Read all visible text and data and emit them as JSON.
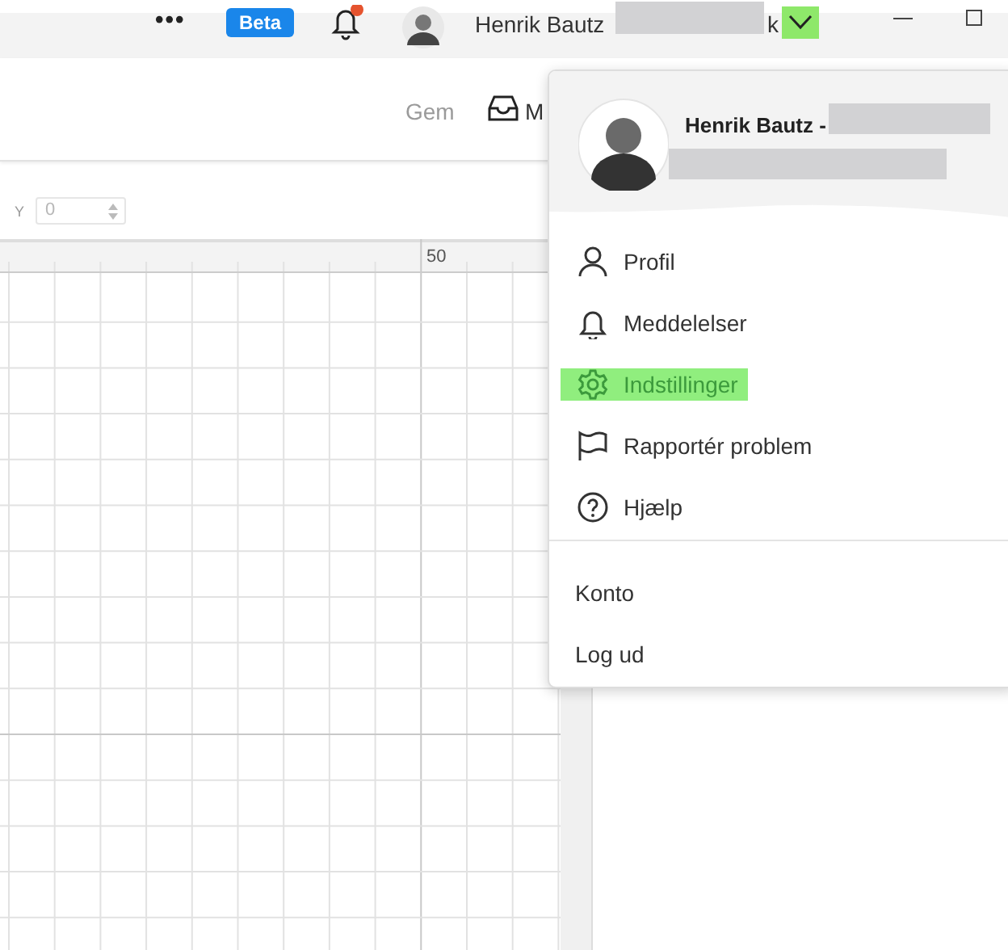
{
  "top_bar": {
    "more": "•••",
    "badge": "Beta",
    "user_name": "Henrik Bautz",
    "user_name_tail": "k"
  },
  "toolbar": {
    "save": "Gem",
    "mail": "M"
  },
  "y_field": {
    "label": "Y",
    "value": "0",
    "disabled": true
  },
  "ruler": {
    "label": "50"
  },
  "user_menu": {
    "name": "Henrik Bautz -",
    "items": [
      {
        "label": "Profil",
        "selected": false
      },
      {
        "label": "Meddelelser",
        "selected": false
      },
      {
        "label": "Indstillinger",
        "selected": true
      },
      {
        "label": "Rapportér problem",
        "selected": false
      },
      {
        "label": "Hjælp",
        "selected": false
      }
    ],
    "account_items": [
      {
        "label": "Konto"
      },
      {
        "label": "Log ud"
      }
    ]
  }
}
